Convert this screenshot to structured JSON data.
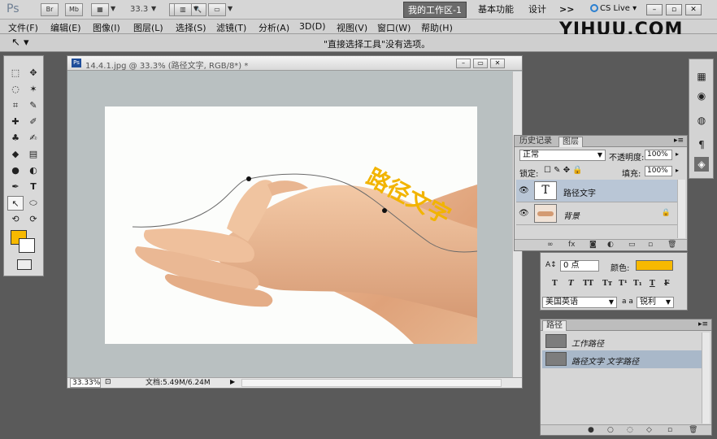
{
  "topbar": {
    "zoom": "33.3",
    "workspace_active": "我的工作区-1",
    "workspace_basic": "基本功能",
    "workspace_design": "设计",
    "more": ">>",
    "cslive": "CS Live"
  },
  "menu": [
    {
      "label": "文件(F)"
    },
    {
      "label": "编辑(E)"
    },
    {
      "label": "图像(I)"
    },
    {
      "label": "图层(L)"
    },
    {
      "label": "选择(S)"
    },
    {
      "label": "滤镜(T)"
    },
    {
      "label": "分析(A)"
    },
    {
      "label": "3D(D)"
    },
    {
      "label": "视图(V)"
    },
    {
      "label": "窗口(W)"
    },
    {
      "label": "帮助(H)"
    }
  ],
  "watermark": "YIHUU.COM",
  "options": {
    "message": "\"直接选择工具\"没有选项。"
  },
  "document": {
    "title": "14.4.1.jpg @ 33.3% (路径文字, RGB/8*) *",
    "zoom": "33.33%",
    "info": "文档:5.49M/6.24M",
    "path_text": "路径文字"
  },
  "layers": {
    "tab_history": "历史记录",
    "tab_layers": "图层",
    "blend_mode": "正常",
    "opacity_label": "不透明度:",
    "opacity": "100%",
    "lock_label": "锁定:",
    "fill_label": "填充:",
    "fill": "100%",
    "items": [
      {
        "name": "路径文字",
        "thumb": "T"
      },
      {
        "name": "背景",
        "thumb": ""
      }
    ]
  },
  "character": {
    "tracking": "0 点",
    "color_label": "颜色:",
    "color": "#f7b900",
    "language": "美国英语",
    "aa_label": "a a",
    "antialias": "锐利"
  },
  "paths": {
    "tab": "路径",
    "items": [
      {
        "name": "工作路径"
      },
      {
        "name": "路径文字 文字路径"
      }
    ]
  },
  "colors": {
    "foreground": "#f7b900",
    "background": "#ffffff",
    "accent_text": "#f2b400"
  }
}
